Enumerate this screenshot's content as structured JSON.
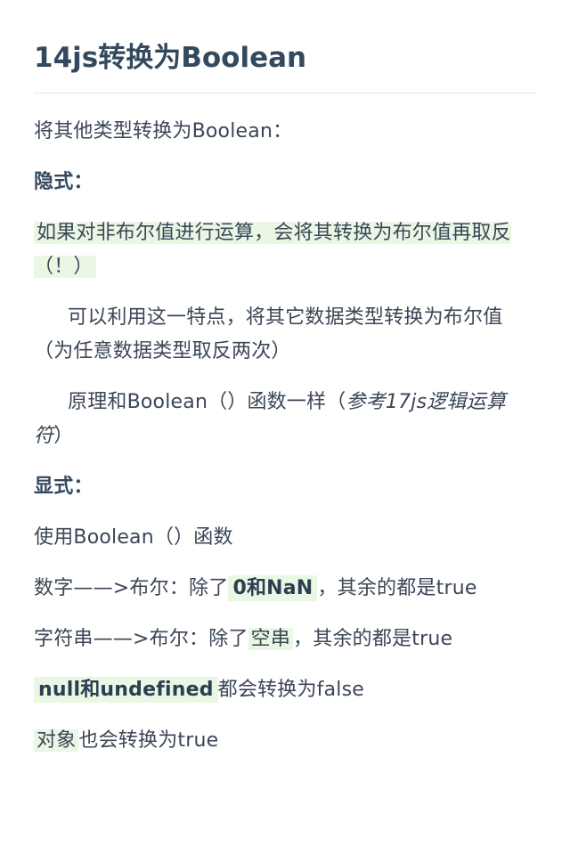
{
  "title": "14js转换为Boolean",
  "intro": "将其他类型转换为Boolean：",
  "implicit": {
    "heading": "隐式：",
    "highlight": "如果对非布尔值进行运算，会将其转换为布尔值再取反（！）",
    "para1": "可以利用这一特点，将其它数据类型转换为布尔值（为任意数据类型取反两次）",
    "para2_prefix": "原理和Boolean（）函数一样（",
    "para2_ref": "参考17js逻辑运算符",
    "para2_suffix": "）"
  },
  "explicit": {
    "heading": "显式：",
    "usage": "使用Boolean（）函数",
    "number_prefix": "数字——>布尔：除了",
    "number_code": "0和NaN",
    "number_suffix": "，其余的都是true",
    "string_prefix": "字符串——>布尔：除了",
    "string_code": "空串",
    "string_suffix": "，其余的都是true",
    "nullish_code": "null和undefined",
    "nullish_suffix": "都会转换为false",
    "object_code": "对象",
    "object_suffix": "也会转换为true"
  }
}
